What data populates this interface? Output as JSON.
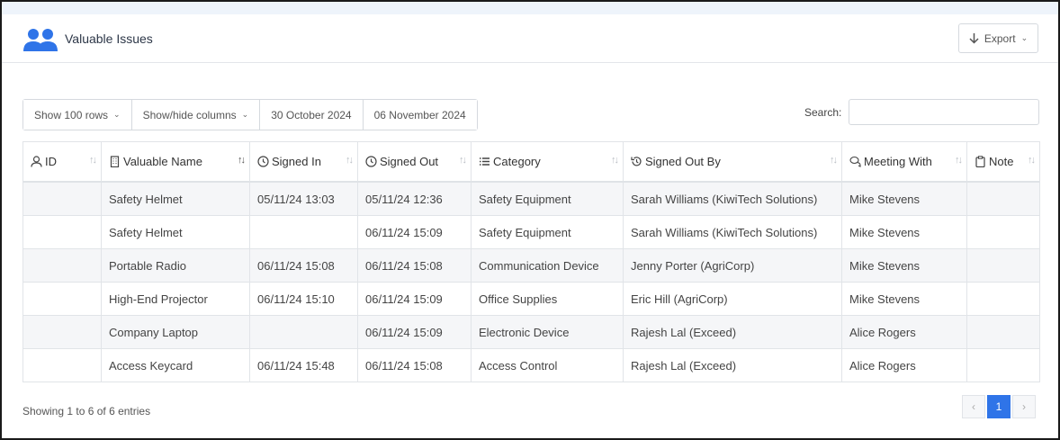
{
  "header": {
    "title": "Valuable Issues",
    "export_label": "Export"
  },
  "toolbar": {
    "show_rows": "Show 100 rows",
    "show_hide": "Show/hide columns",
    "date_from": "30 October 2024",
    "date_to": "06 November 2024"
  },
  "search": {
    "label": "Search:",
    "value": ""
  },
  "table": {
    "columns": [
      "ID",
      "Valuable Name",
      "Signed In",
      "Signed Out",
      "Category",
      "Signed Out By",
      "Meeting With",
      "Note"
    ],
    "rows": [
      [
        "",
        "Safety Helmet",
        "05/11/24 13:03",
        "05/11/24 12:36",
        "Safety Equipment",
        "Sarah Williams (KiwiTech Solutions)",
        "Mike Stevens",
        ""
      ],
      [
        "",
        "Safety Helmet",
        "",
        "06/11/24 15:09",
        "Safety Equipment",
        "Sarah Williams (KiwiTech Solutions)",
        "Mike Stevens",
        ""
      ],
      [
        "",
        "Portable Radio",
        "06/11/24 15:08",
        "06/11/24 15:08",
        "Communication Device",
        "Jenny Porter (AgriCorp)",
        "Mike Stevens",
        ""
      ],
      [
        "",
        "High-End Projector",
        "06/11/24 15:10",
        "06/11/24 15:09",
        "Office Supplies",
        "Eric Hill (AgriCorp)",
        "Mike Stevens",
        ""
      ],
      [
        "",
        "Company Laptop",
        "",
        "06/11/24 15:09",
        "Electronic Device",
        "Rajesh Lal (Exceed)",
        "Alice Rogers",
        ""
      ],
      [
        "",
        "Access Keycard",
        "06/11/24 15:48",
        "06/11/24 15:08",
        "Access Control",
        "Rajesh Lal (Exceed)",
        "Alice Rogers",
        ""
      ]
    ]
  },
  "footer": {
    "info": "Showing 1 to 6 of 6 entries",
    "page": "1",
    "prev": "‹",
    "next": "›"
  },
  "colors": {
    "accent": "#2f74e8",
    "stripe": "#f5f6f8"
  }
}
